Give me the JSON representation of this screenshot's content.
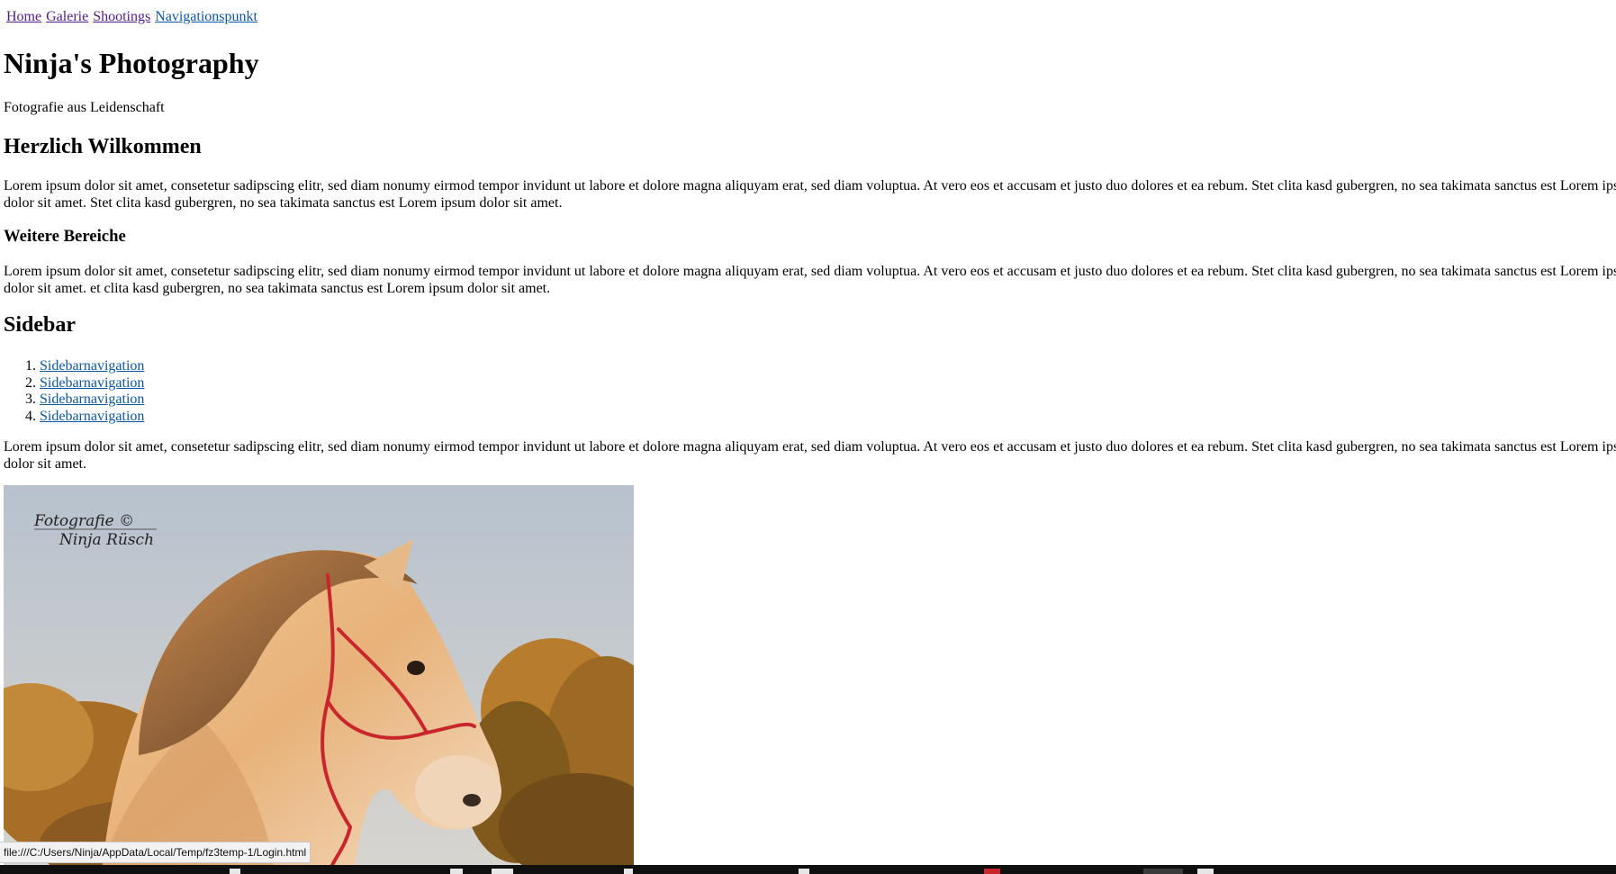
{
  "nav": {
    "items": [
      {
        "label": "Home",
        "state": "visited"
      },
      {
        "label": "Galerie",
        "state": "visited"
      },
      {
        "label": "Shootings",
        "state": "visited"
      },
      {
        "label": "Navigationspunkt",
        "state": "unvisited"
      }
    ]
  },
  "header": {
    "title": "Ninja's Photography",
    "tagline": "Fotografie aus Leidenschaft"
  },
  "main": {
    "welcome_heading": "Herzlich Wilkommen",
    "welcome_text": "Lorem ipsum dolor sit amet, consetetur sadipscing elitr, sed diam nonumy eirmod tempor invidunt ut labore et dolore magna aliquyam erat, sed diam voluptua. At vero eos et accusam et justo duo dolores et ea rebum. Stet clita kasd gubergren, no sea takimata sanctus est Lorem ipsum dolor sit amet. Stet clita kasd gubergren, no sea takimata sanctus est Lorem ipsum dolor sit amet.",
    "further_heading": "Weitere Bereiche",
    "further_text": "Lorem ipsum dolor sit amet, consetetur sadipscing elitr, sed diam nonumy eirmod tempor invidunt ut labore et dolore magna aliquyam erat, sed diam voluptua. At vero eos et accusam et justo duo dolores et ea rebum. Stet clita kasd gubergren, no sea takimata sanctus est Lorem ipsum dolor sit amet. et clita kasd gubergren, no sea takimata sanctus est Lorem ipsum dolor sit amet."
  },
  "sidebar": {
    "heading": "Sidebar",
    "items": [
      {
        "label": "Sidebarnavigation"
      },
      {
        "label": "Sidebarnavigation"
      },
      {
        "label": "Sidebarnavigation"
      },
      {
        "label": "Sidebarnavigation"
      }
    ],
    "text": "Lorem ipsum dolor sit amet, consetetur sadipscing elitr, sed diam nonumy eirmod tempor invidunt ut labore et dolore magna aliquyam erat, sed diam voluptua. At vero eos et accusam et justo duo dolores et ea rebum. Stet clita kasd gubergren, no sea takimata sanctus est Lorem ipsum dolor sit amet."
  },
  "photo": {
    "watermark_line1": "Fotografie ©",
    "watermark_line2": "Ninja Rüsch"
  },
  "statusbar": {
    "url": "file:///C:/Users/Ninja/AppData/Local/Temp/fz3temp-1/Login.html"
  },
  "colors": {
    "visited_link": "#551a8b",
    "unvisited_link": "#0b57a4",
    "halter": "#c8262c"
  }
}
